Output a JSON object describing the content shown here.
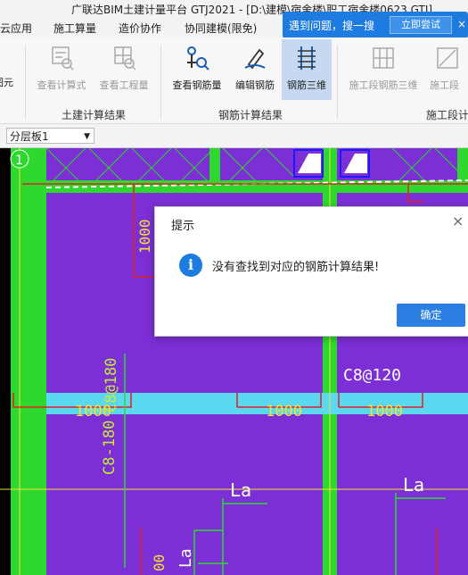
{
  "window": {
    "title": "广联达BIM土建计量平台 GTJ2021 - [D:\\建模\\宿舍楼\\职工宿舍楼0623.GTJ]"
  },
  "menu": {
    "tabs": [
      "云应用",
      "施工算量",
      "造价协作",
      "协同建模(限免)"
    ]
  },
  "notice": {
    "text": "遇到问题，搜一搜",
    "button": "立即尝试",
    "close": "×"
  },
  "ribbon": {
    "left_partial": "图元",
    "buttons": [
      {
        "label": "查看计算式",
        "icon": "formula-view-icon",
        "enabled": false
      },
      {
        "label": "查看工程量",
        "icon": "quantity-view-icon",
        "enabled": false
      },
      {
        "label": "查看钢筋量",
        "icon": "rebar-quantity-icon",
        "enabled": true
      },
      {
        "label": "编辑钢筋",
        "icon": "edit-rebar-icon",
        "enabled": true
      },
      {
        "label": "钢筋三维",
        "icon": "rebar-3d-icon",
        "enabled": true,
        "active": true
      },
      {
        "label": "施工段钢筋三维",
        "icon": "stage-rebar-3d-icon",
        "enabled": false
      },
      {
        "label": "施工段",
        "icon": "stage-rebar-icon",
        "enabled": false
      }
    ],
    "groups": [
      "土建计算结果",
      "钢筋计算结果",
      "施工段计"
    ]
  },
  "toolbar": {
    "layer": "分层板1"
  },
  "drawing": {
    "grid_label": "1",
    "labels": [
      "1000",
      "1000",
      "1000",
      "1000",
      "C8@120",
      "C8@180",
      "C8-180",
      "La",
      "La",
      "La",
      "00"
    ],
    "colors": {
      "slab": "#7b2fd4",
      "beam": "#2ed82e",
      "rebar": "#e02020",
      "band": "#5ad8f0"
    }
  },
  "dialog": {
    "title": "提示",
    "close": "×",
    "message": "没有查找到对应的钢筋计算结果!",
    "ok": "确定"
  }
}
